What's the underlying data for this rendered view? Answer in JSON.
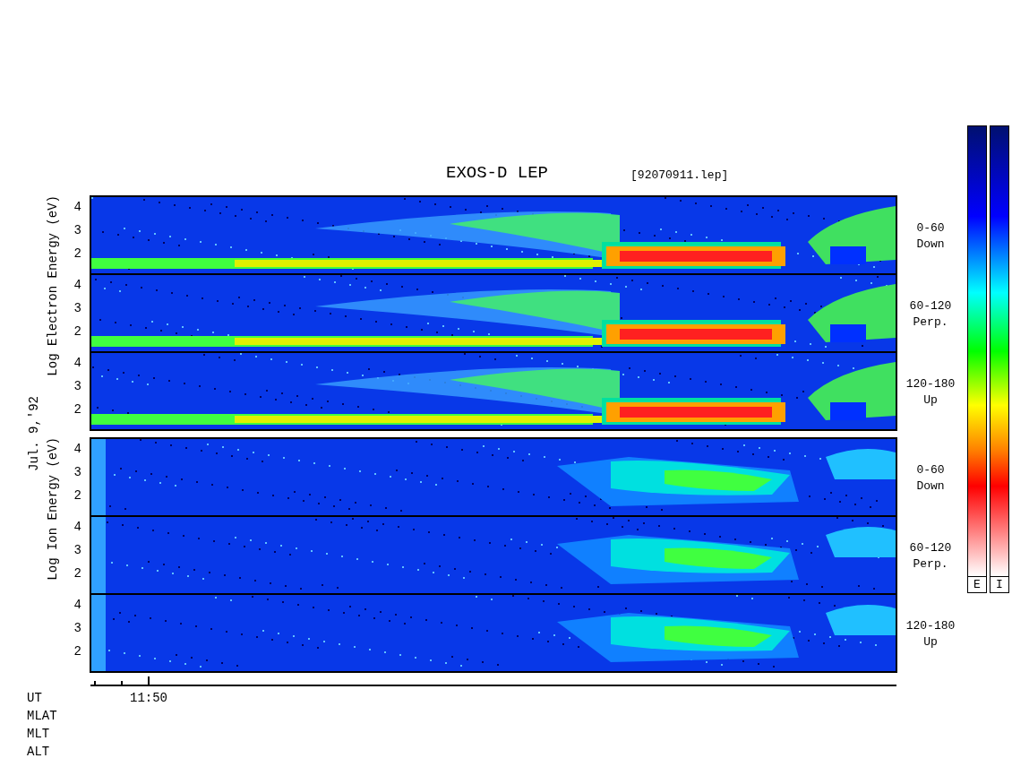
{
  "title": "EXOS-D LEP",
  "file": "[92070911.lep]",
  "date": "Jul. 9,'92",
  "groups": [
    {
      "kind": "electron",
      "axis_label": "Log Electron Energy (eV)",
      "panels": [
        {
          "ticks": [
            "4",
            "3",
            "2"
          ],
          "angle": "0-60",
          "direction": "Down"
        },
        {
          "ticks": [
            "4",
            "3",
            "2"
          ],
          "angle": "60-120",
          "direction": "Perp."
        },
        {
          "ticks": [
            "4",
            "3",
            "2"
          ],
          "angle": "120-180",
          "direction": "Up"
        }
      ]
    },
    {
      "kind": "ion",
      "axis_label": "Log Ion Energy (eV)",
      "panels": [
        {
          "ticks": [
            "4",
            "3",
            "2"
          ],
          "angle": "0-60",
          "direction": "Down"
        },
        {
          "ticks": [
            "4",
            "3",
            "2"
          ],
          "angle": "60-120",
          "direction": "Perp."
        },
        {
          "ticks": [
            "4",
            "3",
            "2"
          ],
          "angle": "120-180",
          "direction": "Up"
        }
      ]
    }
  ],
  "colorbars": [
    {
      "label": "E"
    },
    {
      "label": "I"
    }
  ],
  "time_axis": {
    "tick": "11:50",
    "rows": [
      "UT",
      "MLAT",
      "MLT",
      "ALT"
    ]
  }
}
